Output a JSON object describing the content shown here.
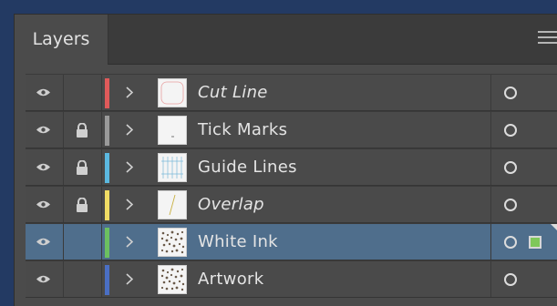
{
  "panel": {
    "tab_title": "Layers",
    "menu_icon": "hamburger-menu-icon"
  },
  "layers": [
    {
      "name": "Cut Line",
      "italic": true,
      "visible": true,
      "locked": false,
      "color": "#e05a5a",
      "thumb": "cut",
      "selected": false
    },
    {
      "name": "Tick Marks",
      "italic": false,
      "visible": true,
      "locked": true,
      "color": "#9a9a9a",
      "thumb": "tick",
      "selected": false
    },
    {
      "name": "Guide Lines",
      "italic": false,
      "visible": true,
      "locked": true,
      "color": "#5bb8e0",
      "thumb": "guide",
      "selected": false
    },
    {
      "name": "Overlap",
      "italic": true,
      "visible": true,
      "locked": true,
      "color": "#f0dc64",
      "thumb": "overlap",
      "selected": false
    },
    {
      "name": "White Ink",
      "italic": false,
      "visible": true,
      "locked": false,
      "color": "#6cc060",
      "thumb": "pattern",
      "selected": true
    },
    {
      "name": "Artwork",
      "italic": false,
      "visible": true,
      "locked": false,
      "color": "#4a6fc4",
      "thumb": "pattern",
      "selected": false
    }
  ],
  "colors": {
    "selected_row": "#4f6e8c",
    "selection_square": "#7fc85a"
  }
}
